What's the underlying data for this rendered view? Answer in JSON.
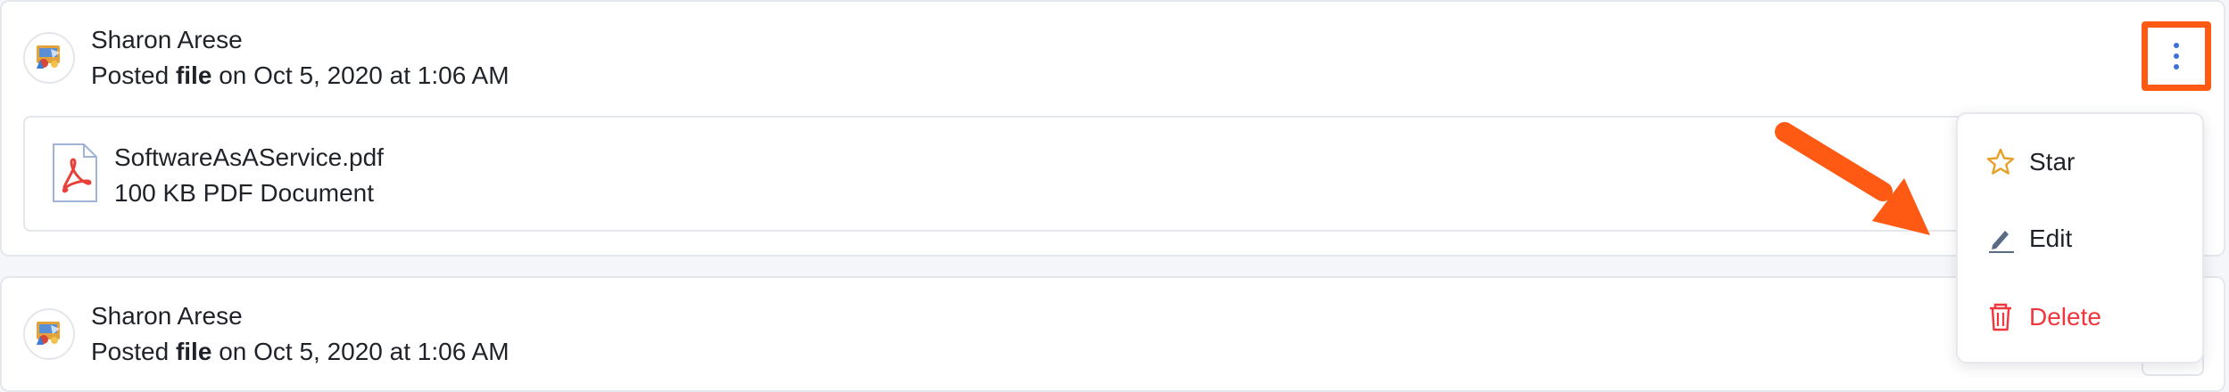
{
  "posts": [
    {
      "author": "Sharon Arese",
      "posted_prefix": "Posted ",
      "posted_type": "file",
      "posted_suffix": " on Oct 5, 2020 at 1:06 AM",
      "attachment": {
        "name": "SoftwareAsAService.pdf",
        "meta": "100 KB PDF Document"
      }
    },
    {
      "author": "Sharon Arese",
      "posted_prefix": "Posted ",
      "posted_type": "file",
      "posted_suffix": " on Oct 5, 2020 at 1:06 AM"
    }
  ],
  "menu": {
    "items": [
      {
        "label": "Star",
        "icon": "star-icon"
      },
      {
        "label": "Edit",
        "icon": "pencil-icon"
      },
      {
        "label": "Delete",
        "icon": "trash-icon"
      }
    ]
  },
  "colors": {
    "highlight": "#ff5a14",
    "kebab_dots": "#3f6fd9",
    "star": "#e8a128",
    "edit_icon": "#5b6b84",
    "delete": "#f0373f"
  }
}
